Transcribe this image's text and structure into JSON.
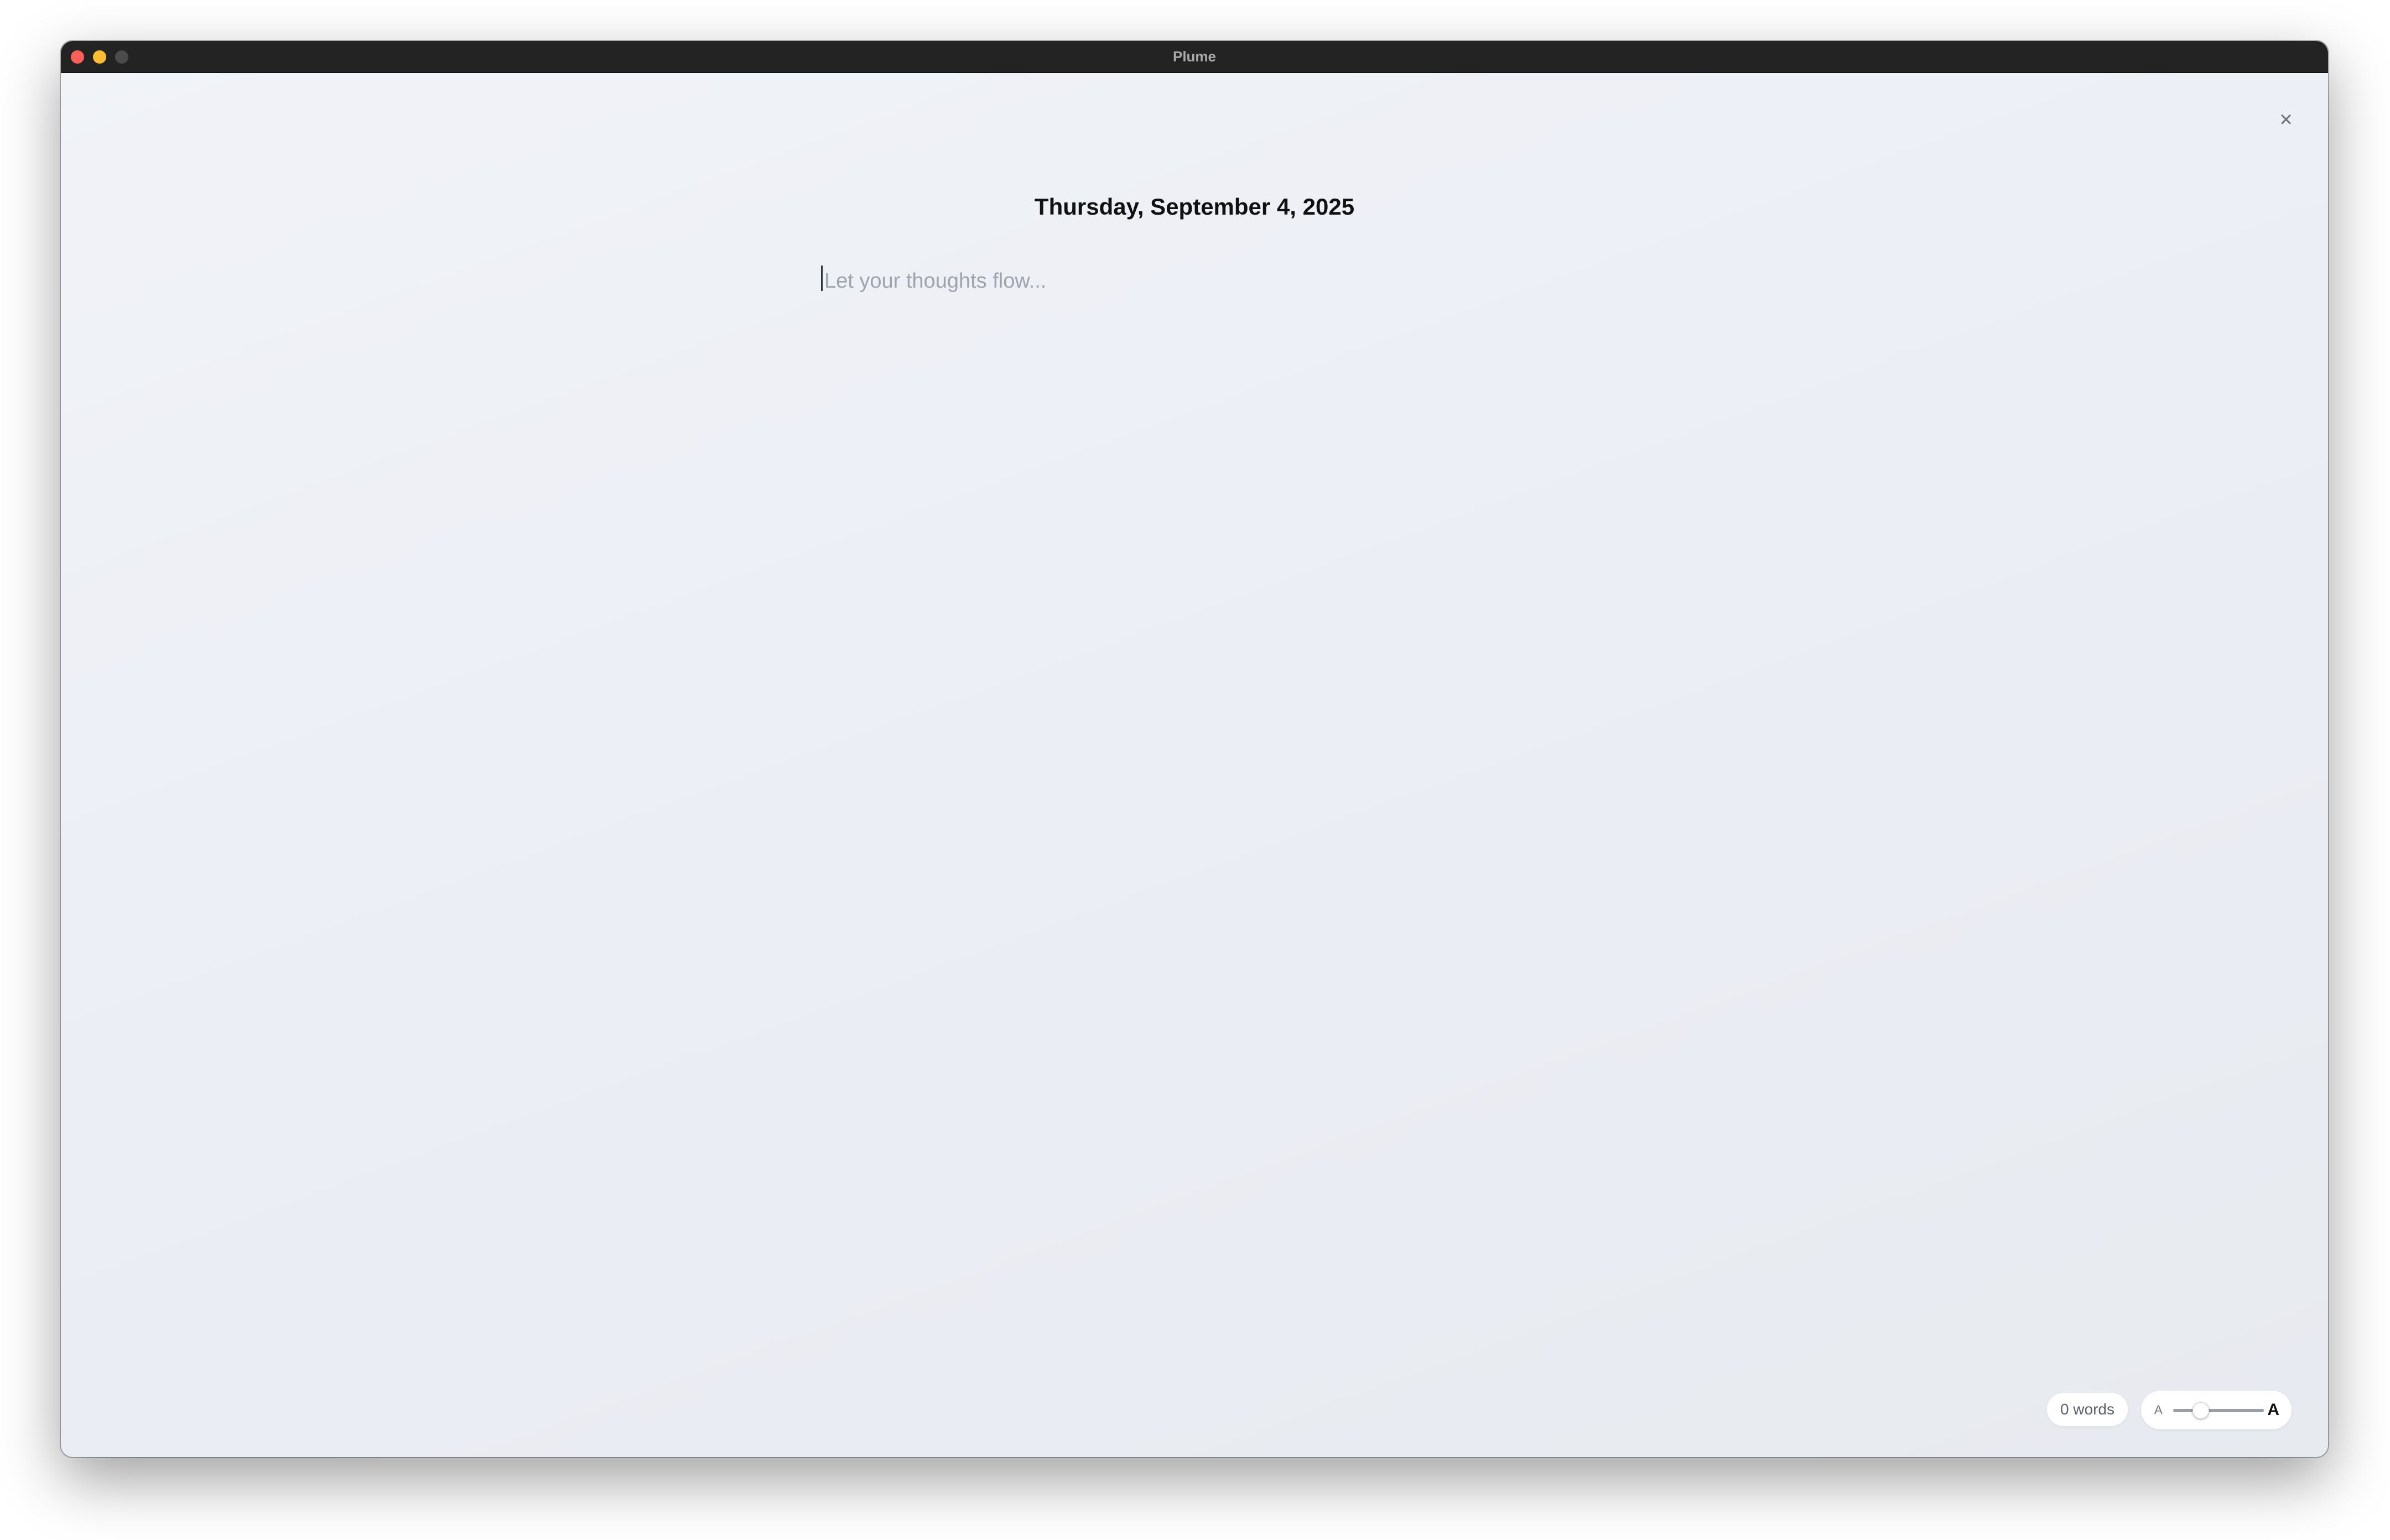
{
  "window": {
    "title": "Plume"
  },
  "entry": {
    "date": "Thursday, September 4, 2025",
    "placeholder": "Let your thoughts flow...",
    "value": ""
  },
  "footer": {
    "word_count": "0 words",
    "font_size_small_label": "A",
    "font_size_large_label": "A",
    "font_size_level": 0.3
  },
  "icons": {
    "close": "close-icon"
  },
  "colors": {
    "close_button": "#fe5f57",
    "minimize_button": "#febc2e",
    "titlebar": "#232323"
  }
}
